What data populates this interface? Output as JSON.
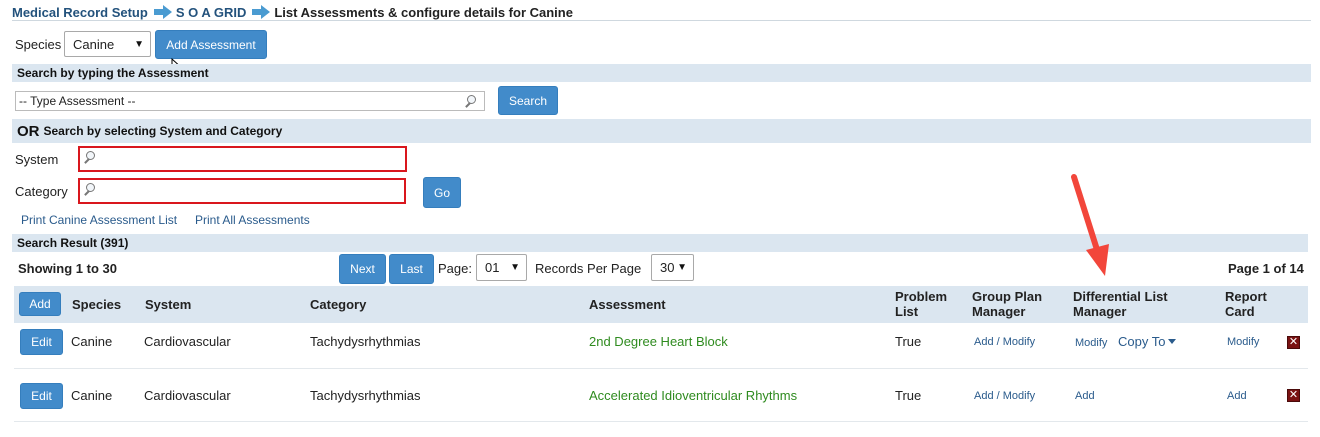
{
  "breadcrumb": {
    "item1": "Medical Record Setup",
    "item2": "S O A GRID",
    "current": "List Assessments & configure details for Canine"
  },
  "species": {
    "label": "Species",
    "selected": "Canine"
  },
  "add_assessment_label": "Add Assessment",
  "search_typing": {
    "heading": "Search by typing the Assessment",
    "placeholder": "-- Type Assessment --",
    "button": "Search"
  },
  "search_selecting": {
    "heading_or": "OR",
    "heading_rest": "Search by selecting System and Category",
    "system_label": "System",
    "category_label": "Category",
    "go_button": "Go"
  },
  "print_links": {
    "canine_list": "Print Canine Assessment List",
    "all": "Print All Assessments"
  },
  "results": {
    "heading": "Search Result (391)",
    "showing": "Showing 1 to 30",
    "next": "Next",
    "last": "Last",
    "page_label": "Page:",
    "page_value": "01",
    "records_label": "Records Per Page",
    "records_value": "30",
    "page_of": "Page 1 of 14"
  },
  "table": {
    "add_button": "Add",
    "headers": {
      "species": "Species",
      "system": "System",
      "category": "Category",
      "assessment": "Assessment",
      "problem_list_1": "Problem",
      "problem_list_2": "List",
      "group_plan_1": "Group Plan",
      "group_plan_2": "Manager",
      "diff_list_1": "Differential List",
      "diff_list_2": "Manager",
      "report_card_1": "Report",
      "report_card_2": "Card"
    },
    "rows": [
      {
        "edit": "Edit",
        "species": "Canine",
        "system": "Cardiovascular",
        "category": "Tachydysrhythmias",
        "assessment": "2nd Degree Heart Block",
        "problem_list": "True",
        "group_plan": "Add / Modify",
        "diff_list": "Modify",
        "copy_to": "Copy To",
        "report_card": "Modify"
      },
      {
        "edit": "Edit",
        "species": "Canine",
        "system": "Cardiovascular",
        "category": "Tachydysrhythmias",
        "assessment": "Accelerated Idioventricular Rhythms",
        "problem_list": "True",
        "group_plan": "Add / Modify",
        "diff_list": "Add",
        "report_card": "Add"
      }
    ]
  },
  "colors": {
    "band": "#dbe6f0",
    "button": "#428bca",
    "assessment_link": "#2f8b1f",
    "error_border": "#d9161d",
    "annotation_arrow": "#f2463b"
  }
}
